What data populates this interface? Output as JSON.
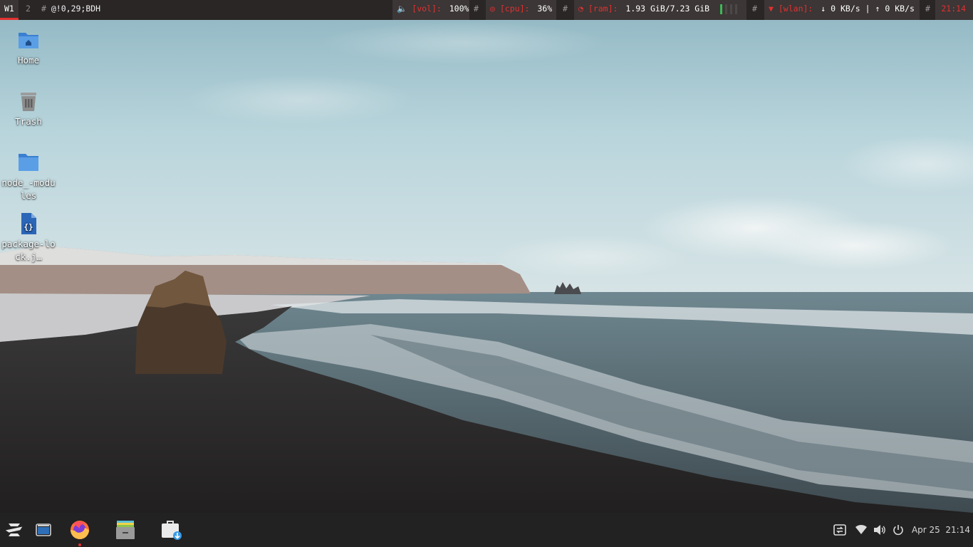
{
  "topbar": {
    "workspaces": [
      {
        "label": "W1",
        "active": true
      },
      {
        "label": "2",
        "active": false
      }
    ],
    "window_sep": "#",
    "window_title": "@!0,29;BDH",
    "sep": "#",
    "volume": {
      "label": "[vol]:",
      "value": "100%"
    },
    "cpu": {
      "label": "[cpu]:",
      "value": "36%"
    },
    "ram": {
      "label": "[ram]:",
      "value": "1.93 GiB/7.23 GiB",
      "bar_level_fraction": 0.25
    },
    "wlan": {
      "label": "[wlan]:",
      "down": "0 KB/s",
      "divider": "|",
      "up": "0 KB/s"
    },
    "clock": "21:14",
    "colors": {
      "accent": "#e3302f",
      "bar_bg": "#2a2626",
      "block_bg": "#3c3636",
      "ram_bar_on": "#3bba55"
    }
  },
  "desktop": {
    "icons": [
      {
        "label": "Home",
        "icon": "home-folder-icon"
      },
      {
        "label": "Trash",
        "icon": "trash-icon"
      },
      {
        "label": "node_-modules",
        "icon": "folder-icon"
      },
      {
        "label": "package-lock.j…",
        "icon": "json-file-icon"
      }
    ]
  },
  "taskbar": {
    "apps": [
      {
        "name": "Zorin menu",
        "icon": "zorin-logo-icon"
      },
      {
        "name": "Workspaces",
        "icon": "workspace-switcher-icon"
      },
      {
        "name": "Firefox",
        "icon": "firefox-icon",
        "running": true
      },
      {
        "name": "Files",
        "icon": "file-cabinet-icon"
      },
      {
        "name": "Software",
        "icon": "software-store-icon"
      }
    ],
    "tray": {
      "icons": [
        "sync-icon",
        "wifi-icon",
        "volume-icon",
        "power-icon"
      ],
      "clock": "Apr 25  21:14"
    }
  }
}
